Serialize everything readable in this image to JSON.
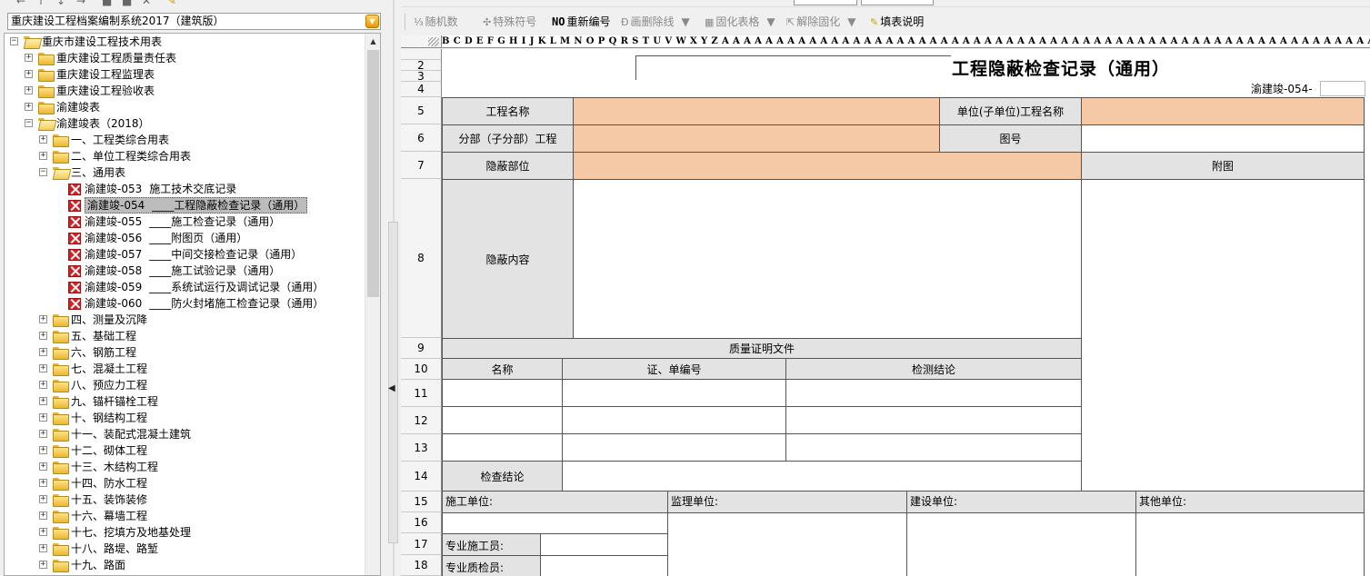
{
  "left_panel": {
    "system_select": {
      "value": "重庆建设工程档案编制系统2017（建筑版）"
    },
    "tree": {
      "root": "重庆市建设工程技术用表",
      "level1": [
        "重庆建设工程质量责任表",
        "重庆建设工程监理表",
        "重庆建设工程验收表",
        "渝建竣表",
        "渝建竣表（2018）"
      ],
      "level2_top": [
        "一、工程类综合用表",
        "二、单位工程类综合用表",
        "三、通用表"
      ],
      "forms": [
        {
          "code": "渝建竣-053",
          "title": "施工技术交底记录",
          "selected": false
        },
        {
          "code": "渝建竣-054",
          "title": "____工程隐蔽检查记录（通用）",
          "selected": true
        },
        {
          "code": "渝建竣-055",
          "title": "____施工检查记录（通用）",
          "selected": false
        },
        {
          "code": "渝建竣-056",
          "title": "____附图页（通用）",
          "selected": false
        },
        {
          "code": "渝建竣-057",
          "title": "____中间交接检查记录（通用）",
          "selected": false
        },
        {
          "code": "渝建竣-058",
          "title": "____施工试验记录（通用）",
          "selected": false
        },
        {
          "code": "渝建竣-059",
          "title": "____系统试运行及调试记录（通用）",
          "selected": false
        },
        {
          "code": "渝建竣-060",
          "title": "____防火封堵施工检查记录（通用）",
          "selected": false
        }
      ],
      "level2_bottom": [
        "四、测量及沉降",
        "五、基础工程",
        "六、钢筋工程",
        "七、混凝土工程",
        "八、预应力工程",
        "九、锚杆锚栓工程",
        "十、钢结构工程",
        "十一、装配式混凝土建筑",
        "十二、砌体工程",
        "十三、木结构工程",
        "十四、防水工程",
        "十五、装饰装修",
        "十六、幕墙工程",
        "十七、挖填方及地基处理",
        "十八、路堤、路堑",
        "十九、路面"
      ]
    }
  },
  "right_panel": {
    "toolbar": [
      {
        "label": "随机数",
        "icon": "random-icon",
        "enabled": false
      },
      {
        "label": "特殊符号",
        "icon": "symbol-icon",
        "enabled": false
      },
      {
        "label": "重新编号",
        "icon": "renumber-icon",
        "prefix": "NO",
        "enabled": true
      },
      {
        "label": "画删除线",
        "icon": "strike-icon",
        "enabled": false
      },
      {
        "label": "固化表格",
        "icon": "lock-table-icon",
        "enabled": false
      },
      {
        "label": "解除固化",
        "icon": "unlock-table-icon",
        "enabled": false
      },
      {
        "label": "填表说明",
        "icon": "fill-guide-icon",
        "enabled": true
      }
    ],
    "column_letters": "B C D E F G H I J K L M N O P Q R S T U V W X Y Z A A A A A A A A A A A A A A A A A A A A A A A A A A A A A A A A A A A A A A A A A A A A A A A A A A A A A A A A A A A A A A A A A A A A A",
    "row_numbers": [
      "2",
      "3",
      "4",
      "5",
      "6",
      "7",
      "8",
      "9",
      "10",
      "11",
      "12",
      "13",
      "14",
      "15",
      "16",
      "17",
      "18"
    ],
    "form": {
      "title": "工程隐蔽检查记录（通用）",
      "code": "渝建竣-054-",
      "project_name_label": "工程名称",
      "unit_project_label": "单位(子单位)工程名称",
      "sub_project_label": "分部（子分部）工程",
      "drawing_no_label": "图号",
      "hidden_part_label": "隐蔽部位",
      "attached_drawing_label": "附图",
      "hidden_content_label": "隐蔽内容",
      "quality_docs_label": "质量证明文件",
      "doc_name_label": "名称",
      "cert_no_label": "证、单编号",
      "test_conclusion_label": "检测结论",
      "check_conclusion_label": "检查结论",
      "construction_unit_label": "施工单位:",
      "supervision_unit_label": "监理单位:",
      "owner_unit_label": "建设单位:",
      "other_unit_label": "其他单位:",
      "construction_worker_label": "专业施工员:",
      "quality_inspector_label": "专业质检员:"
    },
    "colors": {
      "input_fill": "#f6c9a6",
      "label_fill": "#e3e3e3",
      "selection": "#bcbcbc"
    }
  }
}
